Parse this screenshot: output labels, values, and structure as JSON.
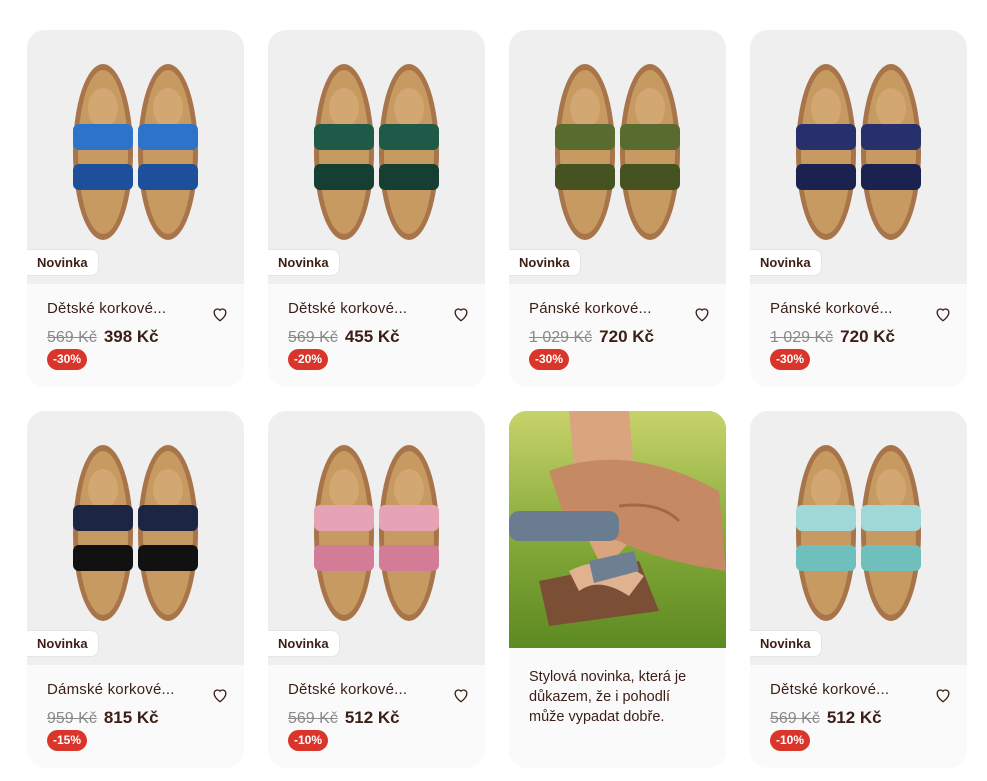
{
  "products": [
    {
      "badge": "Novinka",
      "name": "Dětské korkové...",
      "old_price": "569 Kč",
      "price": "398 Kč",
      "discount": "-30%",
      "colors": {
        "strap": "#2d73c9",
        "accent": "#1e4f9c"
      }
    },
    {
      "badge": "Novinka",
      "name": "Dětské korkové...",
      "old_price": "569 Kč",
      "price": "455 Kč",
      "discount": "-20%",
      "colors": {
        "strap": "#1f5a49",
        "accent": "#153f33"
      }
    },
    {
      "badge": "Novinka",
      "name": "Pánské korkové...",
      "old_price": "1 029 Kč",
      "price": "720 Kč",
      "discount": "-30%",
      "colors": {
        "strap": "#5a6b2f",
        "accent": "#44531f"
      }
    },
    {
      "badge": "Novinka",
      "name": "Pánské korkové...",
      "old_price": "1 029 Kč",
      "price": "720 Kč",
      "discount": "-30%",
      "colors": {
        "strap": "#27306b",
        "accent": "#1b2250"
      }
    },
    {
      "badge": "Novinka",
      "name": "Dámské korkové...",
      "old_price": "959 Kč",
      "price": "815 Kč",
      "discount": "-15%",
      "colors": {
        "strap": "#1d2545",
        "accent": "#111111"
      }
    },
    {
      "badge": "Novinka",
      "name": "Dětské korkové...",
      "old_price": "569 Kč",
      "price": "512 Kč",
      "discount": "-10%",
      "colors": {
        "strap": "#e6a3b6",
        "accent": "#d27c98"
      }
    },
    {
      "badge": "Novinka",
      "name": "Dětské korkové...",
      "old_price": "569 Kč",
      "price": "512 Kč",
      "discount": "-10%",
      "colors": {
        "strap": "#9fd8d6",
        "accent": "#6fbfbc"
      }
    }
  ],
  "promo": {
    "text": "Stylová novinka, která je důkazem, že i pohodlí může vypadat dobře."
  },
  "icons": {
    "wishlist": "heart-outline-icon"
  },
  "palette": {
    "text": "#3b1f17",
    "discount_bg": "#d9352a",
    "cork": "#c79a62",
    "sole": "#a8754a"
  }
}
